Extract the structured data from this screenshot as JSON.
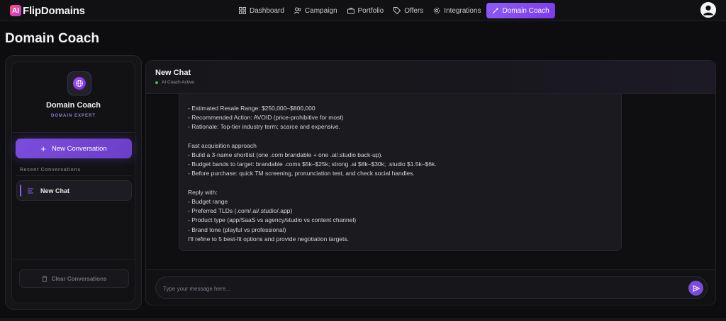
{
  "app": {
    "logo_mark": "AI",
    "logo_text": "FlipDomains"
  },
  "nav": {
    "items": [
      {
        "label": "Dashboard",
        "icon": "grid-icon"
      },
      {
        "label": "Campaign",
        "icon": "users-icon"
      },
      {
        "label": "Portfolio",
        "icon": "briefcase-icon"
      },
      {
        "label": "Offers",
        "icon": "tag-icon"
      },
      {
        "label": "Integrations",
        "icon": "gear-icon"
      },
      {
        "label": "Domain Coach",
        "icon": "wand-icon",
        "active": true
      }
    ]
  },
  "page": {
    "title": "Domain Coach"
  },
  "sidebar": {
    "coach_name": "Domain Coach",
    "coach_subtitle": "DOMAIN EXPERT",
    "new_conversation_label": "New Conversation",
    "recent_label": "Recent Conversations",
    "conversations": [
      {
        "label": "New Chat"
      }
    ],
    "clear_label": "Clear Conversations"
  },
  "chat": {
    "title": "New Chat",
    "status": "AI Coach Active",
    "message_lines": [
      "- Estimated Resale Range: $250,000–$800,000",
      "- Recommended Action: AVOID (price-prohibitive for most)",
      "- Rationale: Top-tier industry term; scarce and expensive.",
      "",
      "Fast acquisition approach",
      "- Build a 3-name shortlist (one .com brandable + one .ai/.studio back-up).",
      "- Budget bands to target: brandable .coms $5k–$25k; strong .ai $8k–$30k; .studio $1.5k–$6k.",
      "- Before purchase: quick TM screening, pronunciation test, and check social handles.",
      "",
      "Reply with:",
      "- Budget range",
      "- Preferred TLDs (.com/.ai/.studio/.app)",
      "- Product type (app/SaaS vs agency/studio vs content channel)",
      "- Brand tone (playful vs professional)",
      "I'll refine to 5 best-fit options and provide negotiation targets."
    ],
    "input_placeholder": "Type your message here..."
  },
  "colors": {
    "accent": "#7c4ddd",
    "background": "#0d0d10",
    "status_active": "#22c55e"
  }
}
